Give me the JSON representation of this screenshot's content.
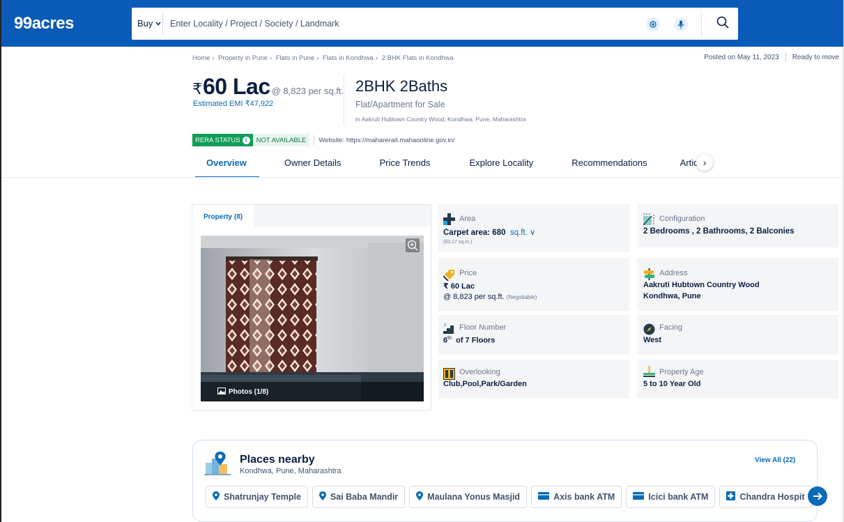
{
  "header": {
    "logo": "99acres",
    "buy_label": "Buy",
    "search_placeholder": "Enter Locality / Project / Society / Landmark"
  },
  "breadcrumb": [
    "Home",
    "Property in Pune",
    "Flats in Pune",
    "Flats in Kondhwa",
    "2 BHK Flats in Kondhwa"
  ],
  "posted": {
    "date_text": "Posted on May 11, 2023",
    "status": "Ready to move"
  },
  "listing": {
    "currency": "₹",
    "price": "60 Lac",
    "price_per_sqft": "@ 8,823 per sq.ft.",
    "emi": "Estimated EMI ₹47,922",
    "title": "2BHK 2Baths",
    "subtitle": "Flat/Apartment for Sale",
    "location": "in Aakruti Hubtown Country Wood, Kondhwa, Pune, Maharashtra"
  },
  "rera": {
    "label": "RERA STATUS",
    "status": "NOT AVAILABLE",
    "website": "Website: https://maharerait.mahaonline.gov.in/"
  },
  "tabs": [
    "Overview",
    "Owner Details",
    "Price Trends",
    "Explore Locality",
    "Recommendations",
    "Article"
  ],
  "photos": {
    "tab_label": "Property (8)",
    "counter": "Photos (1/8)"
  },
  "details": {
    "area": {
      "label": "Area",
      "value_prefix": "Carpet area: 680",
      "unit": "sq.ft.",
      "sub": "(63.17 sq.m.)"
    },
    "configuration": {
      "label": "Configuration",
      "value": "2 Bedrooms , 2 Bathrooms, 2 Balconies"
    },
    "price": {
      "label": "Price",
      "value": "₹ 60 Lac",
      "per_sqft": "@ 8,823 per sq.ft.",
      "negotiable": "(Negotiable)"
    },
    "address": {
      "label": "Address",
      "line1": "Aakruti Hubtown Country Wood",
      "line2": "Kondhwa, Pune"
    },
    "floor": {
      "label": "Floor Number",
      "floor": "6",
      "suffix": "th",
      "of": "of 7 Floors"
    },
    "facing": {
      "label": "Facing",
      "value": "West"
    },
    "overlooking": {
      "label": "Overlooking",
      "value": "Club,Pool,Park/Garden"
    },
    "age": {
      "label": "Property Age",
      "value": "5 to 10 Year Old"
    }
  },
  "places": {
    "title": "Places nearby",
    "subtitle": "Kondhwa, Pune, Maharashtra",
    "view_all": "View All (22)",
    "chips": [
      {
        "label": "Shatrunjay Temple",
        "icon": "location-pin-icon"
      },
      {
        "label": "Sai Baba Mandir",
        "icon": "location-pin-icon"
      },
      {
        "label": "Maulana Yonus Masjid",
        "icon": "location-pin-icon"
      },
      {
        "label": "Axis bank ATM",
        "icon": "atm-card-icon"
      },
      {
        "label": "Icici bank ATM",
        "icon": "atm-card-icon"
      },
      {
        "label": "Chandra Hospit",
        "icon": "hospital-icon"
      }
    ]
  },
  "colors": {
    "brand": "#0a5bb7",
    "link": "#0a6bb7",
    "rera_green": "#0f9d58"
  }
}
